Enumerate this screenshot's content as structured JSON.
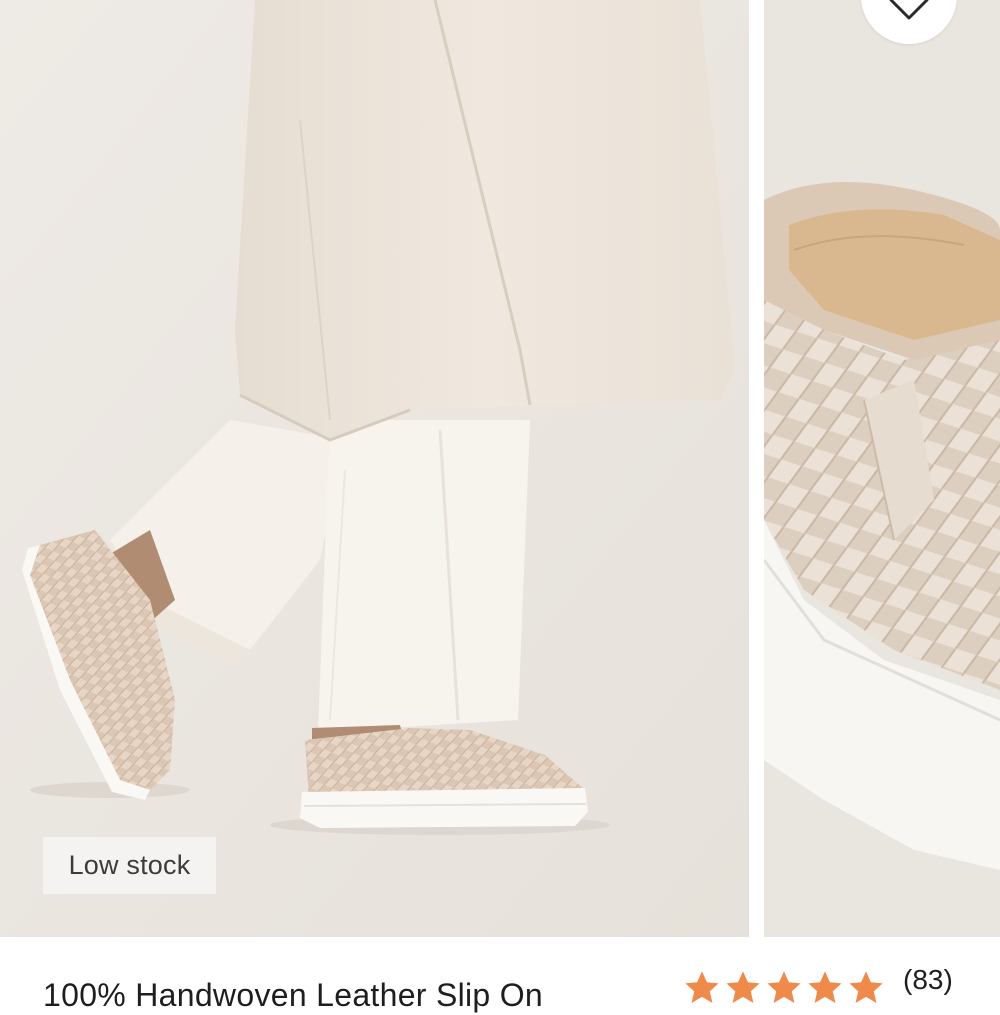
{
  "product": {
    "badge": "Low stock",
    "title": "100% Handwoven Leather Slip On",
    "rating_value": 5,
    "rating_max": 5,
    "review_count": "(83)"
  },
  "gallery": {
    "slides": [
      "model-wearing-slip-on",
      "slip-on-detail"
    ]
  },
  "icons": {
    "wishlist": "heart-icon",
    "star": "star-icon"
  },
  "colors": {
    "star": "#f08a4b",
    "badge_bg": "#f4f3f1",
    "text": "#1e1e1e"
  }
}
